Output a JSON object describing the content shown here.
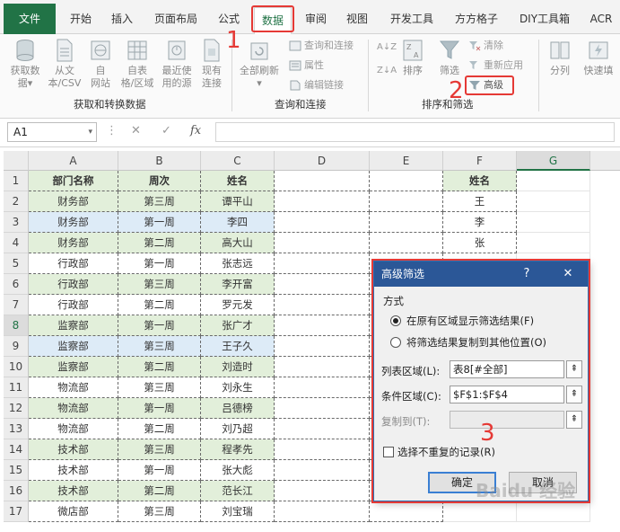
{
  "ribbon_tabs": [
    {
      "label": "文件"
    },
    {
      "label": "开始"
    },
    {
      "label": "插入"
    },
    {
      "label": "页面布局"
    },
    {
      "label": "公式"
    },
    {
      "label": "数据"
    },
    {
      "label": "审阅"
    },
    {
      "label": "视图"
    },
    {
      "label": "开发工具"
    },
    {
      "label": "方方格子"
    },
    {
      "label": "DIY工具箱"
    },
    {
      "label": "ACR"
    }
  ],
  "active_tab": "数据",
  "ribbon": {
    "get_data": {
      "buttons": [
        {
          "line1": "获取数",
          "line2": "据▾"
        },
        {
          "line1": "从文",
          "line2": "本/CSV"
        },
        {
          "line1": "自",
          "line2": "网站"
        },
        {
          "line1": "自表",
          "line2": "格/区域"
        },
        {
          "line1": "最近使",
          "line2": "用的源"
        },
        {
          "line1": "现有",
          "line2": "连接"
        }
      ],
      "group_label": "获取和转换数据"
    },
    "queries": {
      "refresh_line1": "全部刷新",
      "refresh_line2": "▾",
      "items": [
        "查询和连接",
        "属性",
        "编辑链接"
      ],
      "group_label": "查询和连接"
    },
    "sort_filter": {
      "sort_label": "排序",
      "filter_label": "筛选",
      "clear_label": "清除",
      "reapply_label": "重新应用",
      "advanced_label": "高级",
      "group_label": "排序和筛选"
    },
    "tools": {
      "split_label": "分列",
      "flash_fill_label": "快速填"
    }
  },
  "annotations": {
    "one": "1",
    "two": "2",
    "three": "3"
  },
  "formula_bar": {
    "name_box": "A1",
    "name_dropdown": "▾",
    "dots": "⋮",
    "cancel_icon": "✕",
    "enter_icon": "✓",
    "fx_icon": "fx",
    "formula": ""
  },
  "columns": [
    "A",
    "B",
    "C",
    "D",
    "E",
    "F",
    "G"
  ],
  "rows": [
    [
      "部门名称",
      "周次",
      "姓名"
    ],
    [
      "财务部",
      "第三周",
      "谭平山"
    ],
    [
      "财务部",
      "第一周",
      "李四"
    ],
    [
      "财务部",
      "第二周",
      "高大山"
    ],
    [
      "行政部",
      "第一周",
      "张志远"
    ],
    [
      "行政部",
      "第三周",
      "李开富"
    ],
    [
      "行政部",
      "第二周",
      "罗元发"
    ],
    [
      "监察部",
      "第一周",
      "张广才"
    ],
    [
      "监察部",
      "第三周",
      "王子久"
    ],
    [
      "监察部",
      "第二周",
      "刘造时"
    ],
    [
      "物流部",
      "第三周",
      "刘永生"
    ],
    [
      "物流部",
      "第一周",
      "吕德榜"
    ],
    [
      "物流部",
      "第二周",
      "刘乃超"
    ],
    [
      "技术部",
      "第三周",
      "程孝先"
    ],
    [
      "技术部",
      "第一周",
      "张大彪"
    ],
    [
      "技术部",
      "第二周",
      "范长江"
    ],
    [
      "微店部",
      "第三周",
      "刘宝瑞"
    ]
  ],
  "row_numbers": [
    "1",
    "2",
    "3",
    "4",
    "5",
    "6",
    "7",
    "8",
    "9",
    "10",
    "11",
    "12",
    "13",
    "14",
    "15",
    "16",
    "17"
  ],
  "criteria": [
    "姓名",
    "王",
    "李",
    "张"
  ],
  "dialog": {
    "title": "高级筛选",
    "help": "?",
    "close": "✕",
    "section_label": "方式",
    "option_inplace": "在原有区域显示筛选结果(F)",
    "option_copy": "将筛选结果复制到其他位置(O)",
    "list_range_label": "列表区域(L):",
    "list_range_value": "表8[#全部]",
    "criteria_range_label": "条件区域(C):",
    "criteria_range_value": "$F$1:$F$4",
    "copy_to_label": "复制到(T):",
    "copy_to_value": "",
    "unique_label": "选择不重复的记录(R)",
    "ok_label": "确定",
    "cancel_label": "取消",
    "ref_icon": "⇞"
  },
  "watermark": "Baidu 经验",
  "colors": {
    "excel_green": "#217346",
    "header_green": "#e2efda",
    "highlight_blue": "#ddebf7",
    "annotation_red": "#e53935",
    "dialog_title_blue": "#2b5797"
  }
}
